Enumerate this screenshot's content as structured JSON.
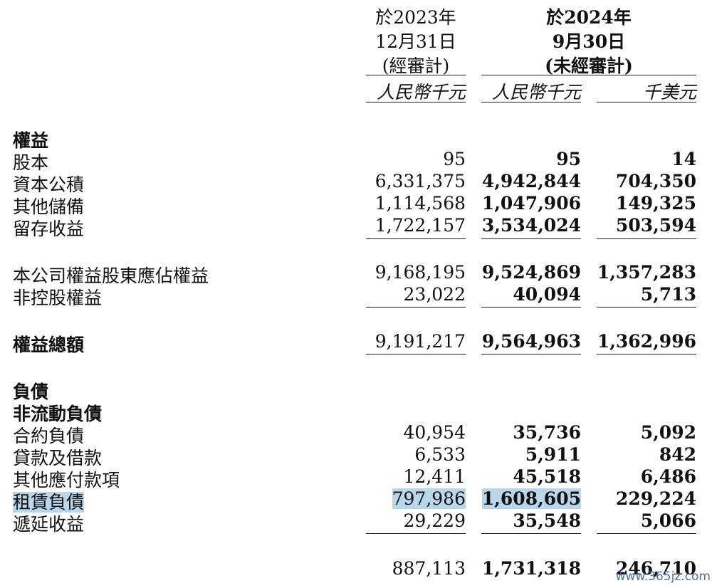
{
  "header": {
    "col_2023": [
      "於2023年",
      "12月31日",
      "(經審計)"
    ],
    "col_2024": [
      "於2024年",
      "9月30日",
      "(未經審計)"
    ],
    "units": [
      "人民幣千元",
      "人民幣千元",
      "千美元"
    ]
  },
  "sections": {
    "equity": "權益",
    "liabilities": "負債",
    "non_current_liabilities": "非流動負債"
  },
  "rows": {
    "share_capital": {
      "label": "股本",
      "v2023": "95",
      "v2024": "95",
      "usd": "14"
    },
    "capital_reserve": {
      "label": "資本公積",
      "v2023": "6,331,375",
      "v2024": "4,942,844",
      "usd": "704,350"
    },
    "other_reserves": {
      "label": "其他儲備",
      "v2023": "1,114,568",
      "v2024": "1,047,906",
      "usd": "149,325"
    },
    "retained_earnings": {
      "label": "留存收益",
      "v2023": "1,722,157",
      "v2024": "3,534,024",
      "usd": "503,594"
    },
    "equity_attributable": {
      "label": "本公司權益股東應佔權益",
      "v2023": "9,168,195",
      "v2024": "9,524,869",
      "usd": "1,357,283"
    },
    "non_controlling": {
      "label": "非控股權益",
      "v2023": "23,022",
      "v2024": "40,094",
      "usd": "5,713"
    },
    "total_equity": {
      "label": "權益總額",
      "v2023": "9,191,217",
      "v2024": "9,564,963",
      "usd": "1,362,996"
    },
    "contract_liabilities": {
      "label": "合約負債",
      "v2023": "40,954",
      "v2024": "35,736",
      "usd": "5,092"
    },
    "loans_borrowings": {
      "label": "貸款及借款",
      "v2023": "6,533",
      "v2024": "5,911",
      "usd": "842"
    },
    "other_payables": {
      "label": "其他應付款項",
      "v2023": "12,411",
      "v2024": "45,518",
      "usd": "6,486"
    },
    "lease_liabilities": {
      "label": "租賃負債",
      "v2023": "797,986",
      "v2024": "1,608,605",
      "usd": "229,224"
    },
    "deferred_income": {
      "label": "遞延收益",
      "v2023": "29,229",
      "v2024": "35,548",
      "usd": "5,066"
    },
    "total_non_current": {
      "v2023": "887,113",
      "v2024": "1,731,318",
      "usd": "246,710"
    }
  },
  "highlight_color": "#b9d6ea",
  "watermark": "www.365jz.com"
}
